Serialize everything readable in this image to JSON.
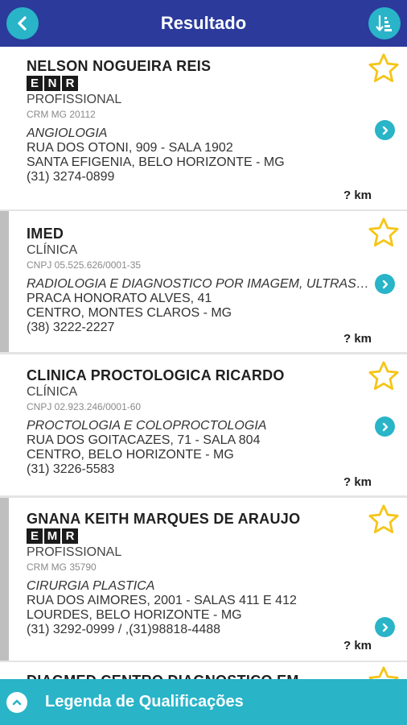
{
  "header": {
    "title": "Resultado",
    "back_icon": "chevron-left-icon",
    "sort_icon": "sort-icon"
  },
  "colors": {
    "header_bg": "#2b3a9b",
    "accent": "#29b4c8",
    "star": "#f5c518"
  },
  "results": [
    {
      "name": "NELSON NOGUEIRA REIS",
      "badges": [
        "E",
        "N",
        "R"
      ],
      "type": "PROFISSIONAL",
      "registration": "CRM MG 20112",
      "specialty": "ANGIOLOGIA",
      "address": "RUA DOS OTONI, 909 - SALA 1902",
      "district": "SANTA EFIGENIA, BELO HORIZONTE - MG",
      "phone": "(31) 3274-0899",
      "distance": "? km"
    },
    {
      "name": "IMED",
      "type": "CLÍNICA",
      "registration": "CNPJ 05.525.626/0001-35",
      "specialty": "RADIOLOGIA E DIAGNOSTICO POR IMAGEM, ULTRASSONOGRAFIA",
      "address": "PRACA HONORATO ALVES, 41",
      "district": "CENTRO, MONTES CLAROS - MG",
      "phone": "(38) 3222-2227",
      "distance": "? km"
    },
    {
      "name": "CLINICA PROCTOLOGICA RICARDO",
      "type": "CLÍNICA",
      "registration": "CNPJ 02.923.246/0001-60",
      "specialty": "PROCTOLOGIA E COLOPROCTOLOGIA",
      "address": "RUA DOS GOITACAZES, 71 - SALA 804",
      "district": "CENTRO, BELO HORIZONTE - MG",
      "phone": "(31) 3226-5583",
      "distance": "? km"
    },
    {
      "name": "GNANA KEITH MARQUES DE ARAUJO",
      "badges": [
        "E",
        "M",
        "R"
      ],
      "type": "PROFISSIONAL",
      "registration": "CRM MG 35790",
      "specialty": "CIRURGIA PLASTICA",
      "address": "RUA DOS AIMORES, 2001 - SALAS 411 E 412",
      "district": "LOURDES, BELO HORIZONTE - MG",
      "phone": "(31) 3292-0999 / ,(31)98818-4488",
      "distance": "? km"
    },
    {
      "name": "DIAGMED CENTRO DIAGNOSTICO EM"
    }
  ],
  "footer": {
    "label": "Legenda de Qualificações",
    "expand_icon": "chevron-up-icon"
  }
}
